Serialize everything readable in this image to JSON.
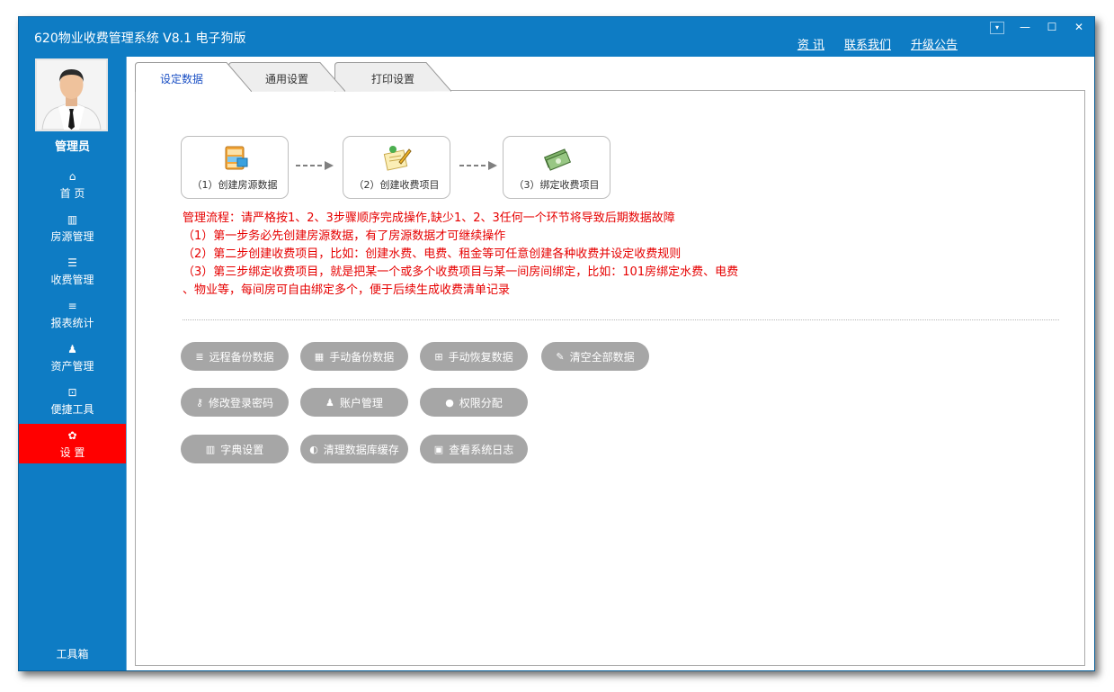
{
  "window": {
    "title": "620物业收费管理系统 V8.1  电子狗版",
    "links": [
      "资 讯",
      "联系我们",
      "升级公告"
    ],
    "controls": [
      "▾",
      "—",
      "☐",
      "✕"
    ]
  },
  "sidebar": {
    "user_name": "管理员",
    "items": [
      {
        "label": "首 页",
        "icon": "⌂"
      },
      {
        "label": "房源管理",
        "icon": "▥"
      },
      {
        "label": "收费管理",
        "icon": "☰"
      },
      {
        "label": "报表统计",
        "icon": "≡"
      },
      {
        "label": "资产管理",
        "icon": "♟"
      },
      {
        "label": "便捷工具",
        "icon": "⊡"
      },
      {
        "label": "设 置",
        "icon": "✿"
      }
    ],
    "active_index": 6,
    "toolbox_label": "工具箱"
  },
  "tabs": [
    {
      "label": "设定数据",
      "active": true
    },
    {
      "label": "通用设置",
      "active": false
    },
    {
      "label": "打印设置",
      "active": false
    }
  ],
  "steps": [
    {
      "label": "（1）创建房源数据",
      "icon": "cabinet-icon"
    },
    {
      "label": "（2）创建收费项目",
      "icon": "edit-note-icon"
    },
    {
      "label": "（3）绑定收费项目",
      "icon": "money-icon"
    }
  ],
  "flow_text": [
    "管理流程：请严格按1、2、3步骤顺序完成操作,缺少1、2、3任何一个环节将导致后期数据故障",
    "（1）第一步务必先创建房源数据，有了房源数据才可继续操作",
    "（2）第二步创建收费项目，比如：创建水费、电费、租金等可任意创建各种收费并设定收费规则",
    "（3）第三步绑定收费项目，就是把某一个或多个收费项目与某一间房间绑定，比如：101房绑定水费、电费",
    "、物业等，每间房可自由绑定多个，便于后续生成收费清单记录"
  ],
  "buttons": [
    {
      "label": "远程备份数据",
      "icon": "≣"
    },
    {
      "label": "手动备份数据",
      "icon": "▦"
    },
    {
      "label": "手动恢复数据",
      "icon": "⊞"
    },
    {
      "label": "清空全部数据",
      "icon": "✎"
    },
    {
      "label": "修改登录密码",
      "icon": "⚷"
    },
    {
      "label": "账户管理",
      "icon": "♟"
    },
    {
      "label": "权限分配",
      "icon": "●"
    },
    {
      "label": "字典设置",
      "icon": "▥"
    },
    {
      "label": "清理数据库缓存",
      "icon": "◐"
    },
    {
      "label": "查看系统日志",
      "icon": "▣"
    }
  ],
  "colors": {
    "frame_blue": "#0e7cc4",
    "active_red": "#ff0000",
    "flow_text_red": "#e60000",
    "button_gray": "#a6a6a6"
  }
}
